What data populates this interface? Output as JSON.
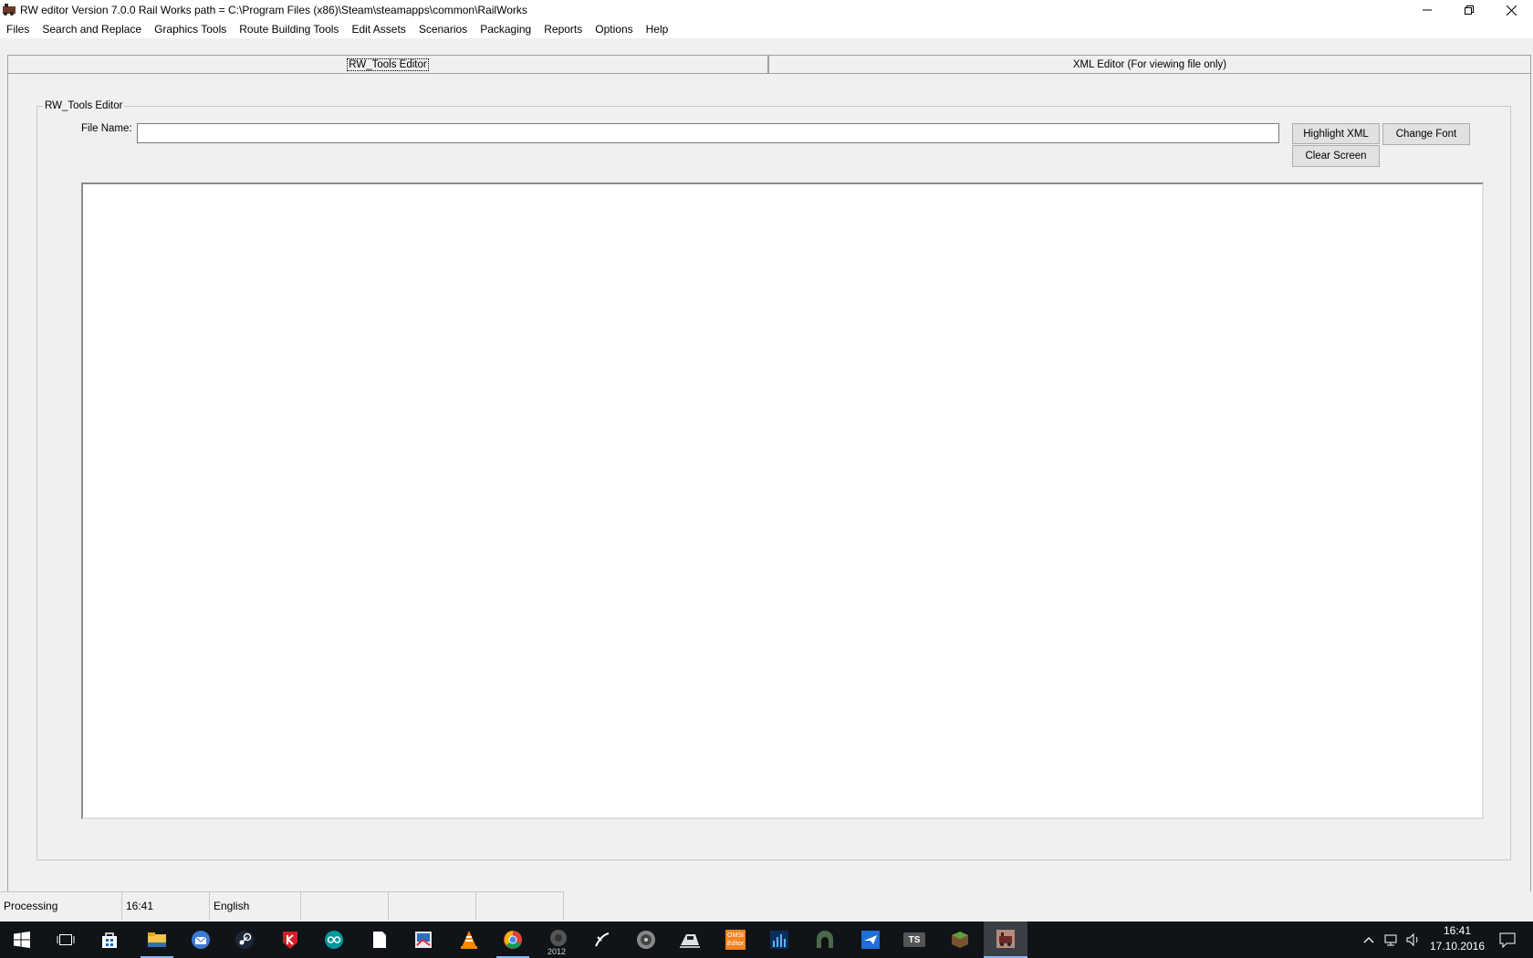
{
  "window": {
    "title": "RW editor  Version 7.0.0  Rail Works path = C:\\Program Files (x86)\\Steam\\steamapps\\common\\RailWorks",
    "controls": [
      "minimize-icon",
      "restore-icon",
      "close-icon"
    ]
  },
  "menu": {
    "items": [
      "Files",
      "Search and Replace",
      "Graphics Tools",
      "Route Building Tools",
      "Edit Assets",
      "Scenarios",
      "Packaging",
      "Reports",
      "Options",
      "Help"
    ]
  },
  "tabs": [
    {
      "label": "RW_Tools Editor",
      "active": true
    },
    {
      "label": "XML Editor (For viewing file only)",
      "active": false
    }
  ],
  "editor": {
    "group_title": "RW_Tools Editor",
    "file_name_label": "File Name:",
    "file_name_value": "",
    "buttons": {
      "highlight": "Highlight XML",
      "clear": "Clear Screen",
      "font": "Change Font"
    },
    "content": ""
  },
  "status": {
    "cells": [
      "Processing",
      "16:41",
      "English",
      "",
      "",
      ""
    ]
  },
  "taskbar": {
    "apps": [
      "start-icon",
      "task-view-icon",
      "store-icon",
      "file-explorer-icon",
      "thunderbird-icon",
      "steam-icon",
      "kaspersky-icon",
      "arduino-icon",
      "notepad-icon",
      "image-editor-icon",
      "vlc-icon",
      "chrome-icon",
      "app-2012-icon",
      "blender-icon",
      "disc-icon",
      "train-sim-icon",
      "omsi-editor-icon",
      "chart-app-icon",
      "tunnel-app-icon",
      "flight-sim-icon",
      "ts-icon",
      "minecraft-icon",
      "rw-editor-icon"
    ],
    "omsi_label": "OMSI Editor",
    "ts_label": "TS",
    "app2012_label": "2012",
    "clock_time": "16:41",
    "clock_date": "17.10.2016"
  },
  "colors": {
    "window_bg": "#f0f0f0",
    "taskbar_bg": "#101418",
    "accent": "#8ab4f8"
  }
}
